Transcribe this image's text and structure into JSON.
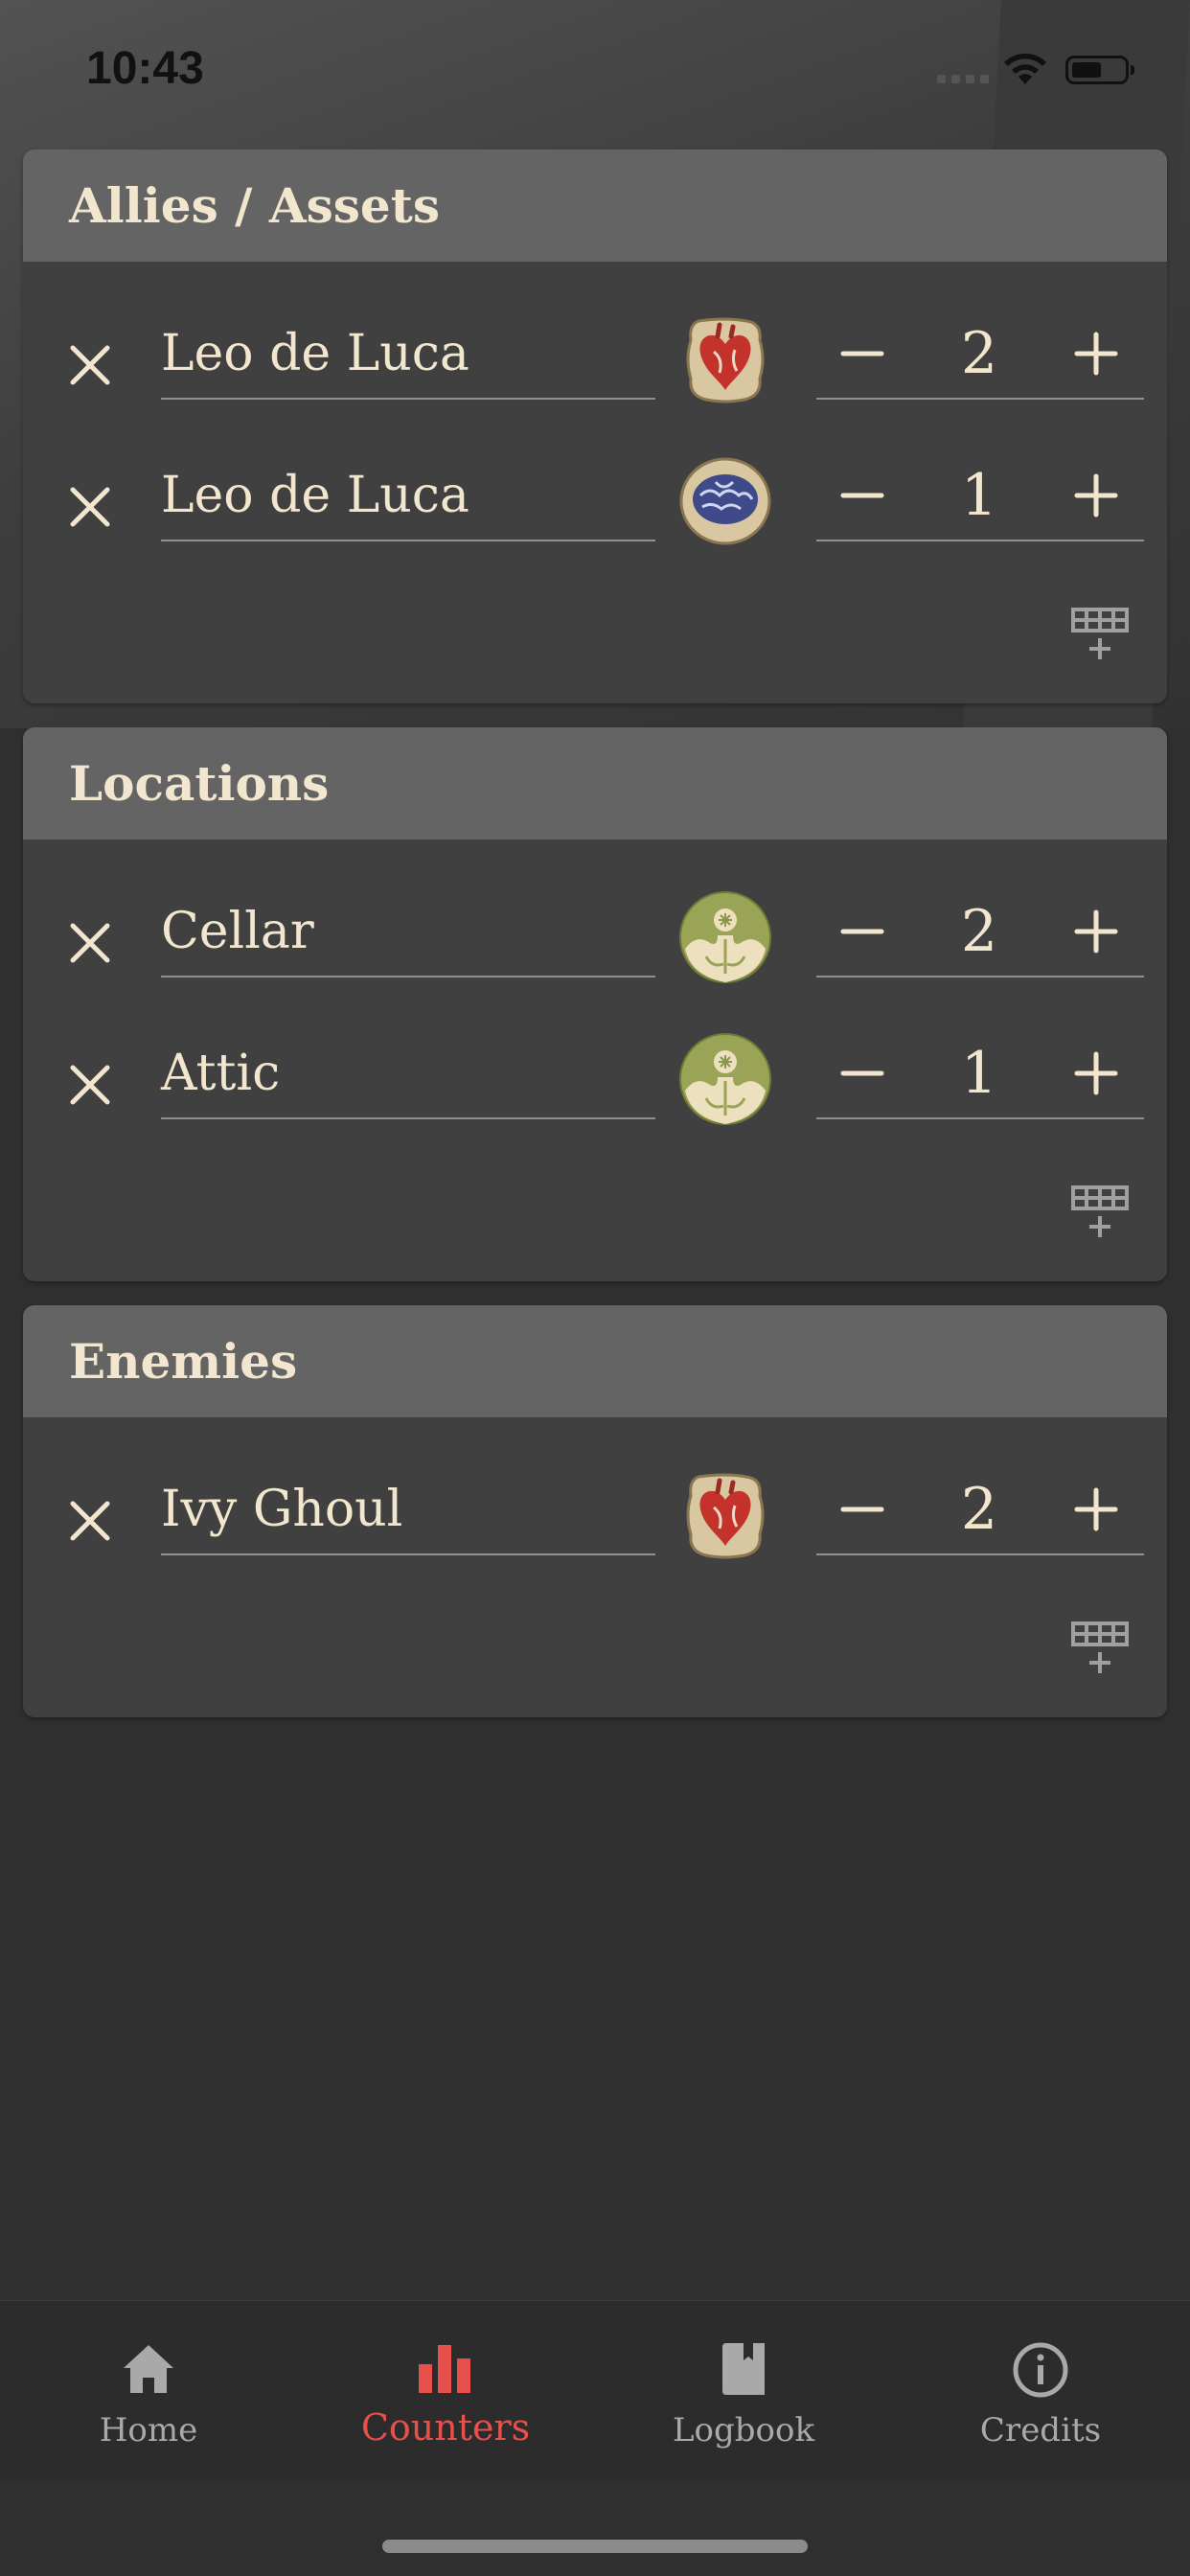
{
  "status_bar": {
    "time": "10:43"
  },
  "colors": {
    "accent": "#e8504c",
    "text": "#f2e6cf",
    "header_bg": "#646464",
    "panel_bg": "#404040"
  },
  "sections": [
    {
      "title": "Allies / Assets",
      "rows": [
        {
          "name": "Leo de Luca",
          "token": "heart-token-icon",
          "value": "2"
        },
        {
          "name": "Leo de Luca",
          "token": "brain-token-icon",
          "value": "1"
        }
      ]
    },
    {
      "title": "Locations",
      "rows": [
        {
          "name": "Cellar",
          "token": "clue-token-icon",
          "value": "2"
        },
        {
          "name": "Attic",
          "token": "clue-token-icon",
          "value": "1"
        }
      ]
    },
    {
      "title": "Enemies",
      "rows": [
        {
          "name": "Ivy Ghoul",
          "token": "heart-token-icon",
          "value": "2"
        }
      ]
    }
  ],
  "tabs": [
    {
      "label": "Home",
      "icon": "home-icon",
      "active": false
    },
    {
      "label": "Counters",
      "icon": "bar-chart-icon",
      "active": true
    },
    {
      "label": "Logbook",
      "icon": "book-icon",
      "active": false
    },
    {
      "label": "Credits",
      "icon": "info-icon",
      "active": false
    }
  ]
}
